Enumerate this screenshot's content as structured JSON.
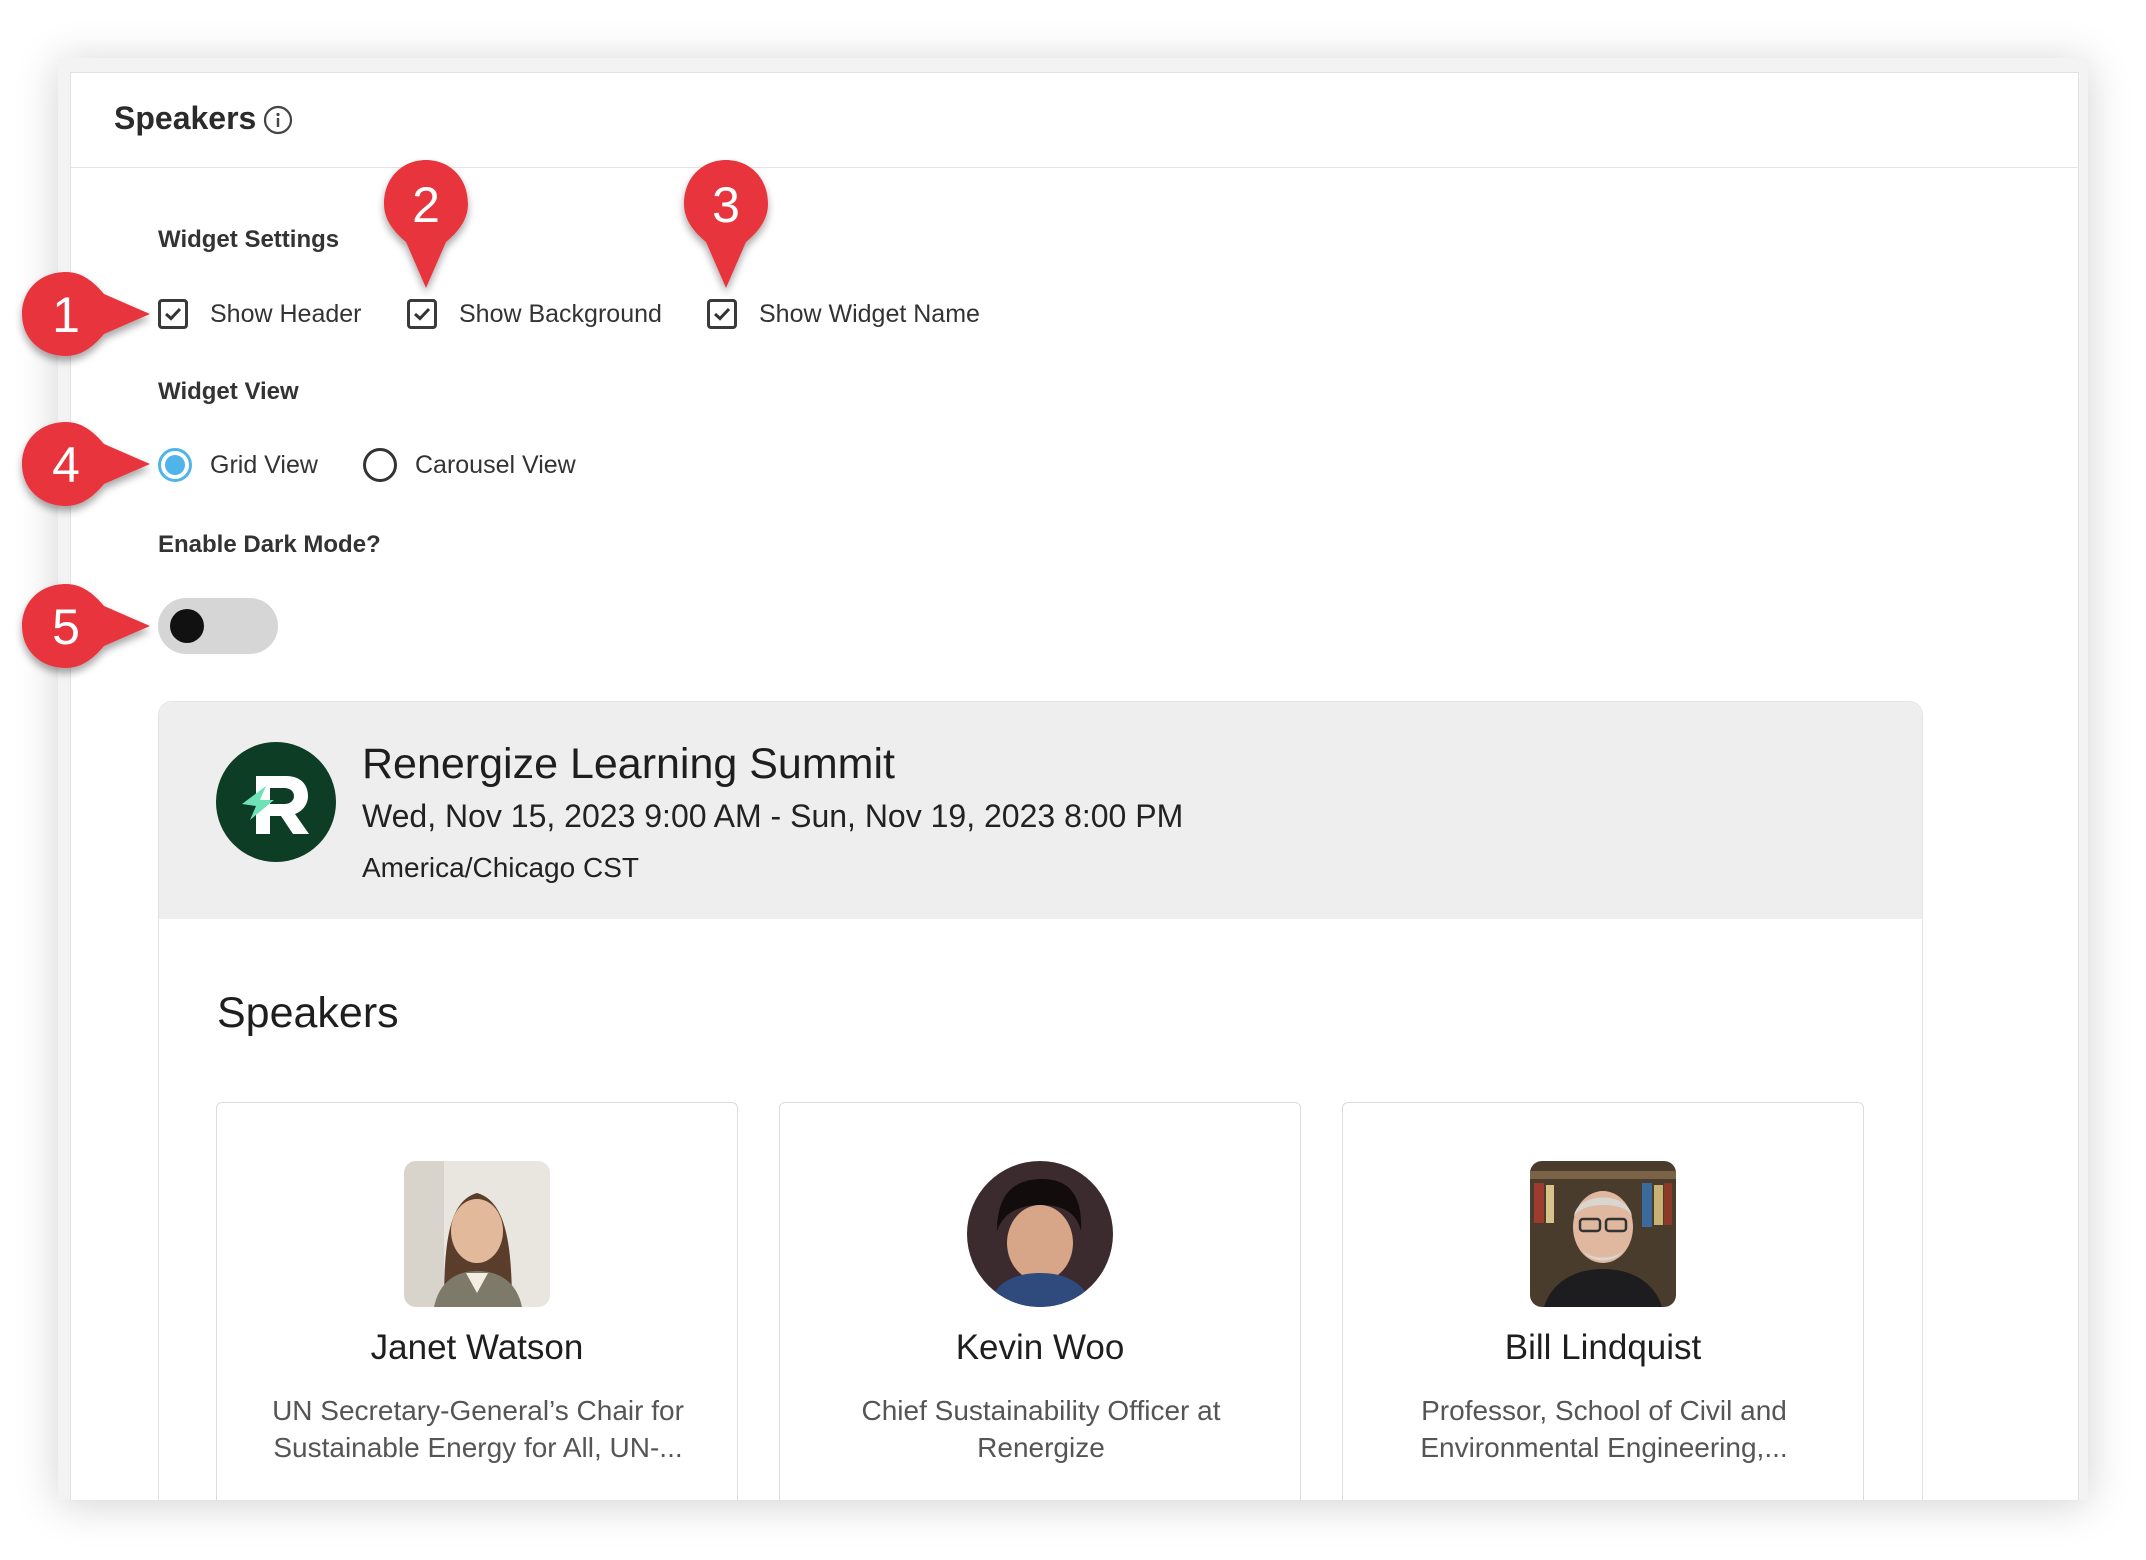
{
  "panel": {
    "title": "Speakers",
    "info_icon": "info-icon"
  },
  "settings": {
    "widget_settings_label": "Widget Settings",
    "checkboxes": [
      {
        "label": "Show Header",
        "checked": true
      },
      {
        "label": "Show Background",
        "checked": true
      },
      {
        "label": "Show Widget Name",
        "checked": true
      }
    ],
    "widget_view_label": "Widget View",
    "views": [
      {
        "label": "Grid View",
        "selected": true
      },
      {
        "label": "Carousel View",
        "selected": false
      }
    ],
    "dark_mode_label": "Enable Dark Mode?",
    "dark_mode_enabled": false
  },
  "preview": {
    "event_title": "Renergize Learning Summit",
    "event_dates": "Wed, Nov 15, 2023 9:00 AM - Sun, Nov 19, 2023 8:00 PM",
    "event_timezone": "America/Chicago CST",
    "speakers_heading": "Speakers",
    "speakers": [
      {
        "name": "Janet Watson",
        "role_line1": "UN Secretary-General’s Chair for",
        "role_line2": "Sustainable Energy for All, UN-..."
      },
      {
        "name": "Kevin Woo",
        "role_line1": "Chief Sustainability Officer at",
        "role_line2": "Renergize"
      },
      {
        "name": "Bill Lindquist",
        "role_line1": "Professor, School of Civil and",
        "role_line2": "Environmental Engineering,..."
      }
    ]
  },
  "annotations": [
    "1",
    "2",
    "3",
    "4",
    "5"
  ],
  "colors": {
    "accent_blue": "#4fb4ea",
    "marker_red": "#e8363d",
    "logo_green": "#0d3d25",
    "logo_mint": "#6fe3b7"
  }
}
